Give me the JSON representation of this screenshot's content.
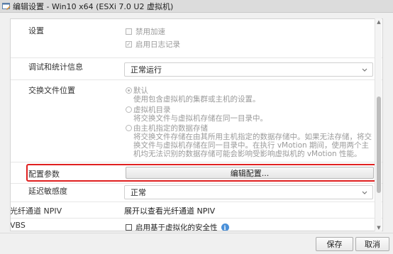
{
  "window": {
    "title": "编辑设置 - Win10 x64 (ESXi 7.0 U2 虚拟机)"
  },
  "rows": {
    "settings": {
      "label": "设置",
      "disable_accel": "禁用加速",
      "enable_logging": "启用日志记录"
    },
    "debug": {
      "label": "调试和统计信息",
      "value": "正常运行"
    },
    "swap": {
      "label": "交换文件位置",
      "options": [
        {
          "title": "默认",
          "desc": "使用包含虚拟机的集群或主机的设置。"
        },
        {
          "title": "虚拟机目录",
          "desc": "将交换文件与虚拟机存储在同一目录中。"
        },
        {
          "title": "由主机指定的数据存储",
          "desc": "将交换文件存储在由其所用主机指定的数据存储中。如果无法存储，将交换文件与虚拟机存储在同一目录中。在执行 vMotion 期间，使用两个主机均无法识别的数据存储可能会影响受影响虚拟机的 vMotion 性能。"
        }
      ]
    },
    "config": {
      "label": "配置参数",
      "button": "编辑配置..."
    },
    "latency": {
      "label": "延迟敏感度",
      "value": "正常"
    },
    "npiv": {
      "label": "光纤通道 NPIV",
      "value": "展开以查看光纤通道 NPIV"
    },
    "vbs": {
      "label": "VBS",
      "value": "启用基于虚拟化的安全性"
    }
  },
  "footer": {
    "save": "保存",
    "cancel": "取消"
  },
  "colors": {
    "highlight": "#e02020",
    "info": "#4a90d9"
  }
}
